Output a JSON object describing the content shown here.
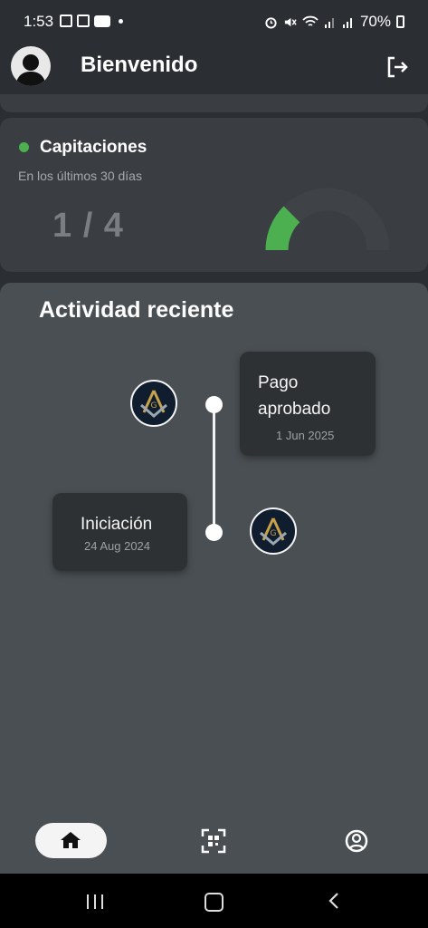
{
  "status_bar": {
    "time": "1:53",
    "battery": "70%"
  },
  "header": {
    "title": "Bienvenido"
  },
  "capitaciones": {
    "title": "Capitaciones",
    "subtitle": "En los últimos 30 días",
    "value": "1 / 4",
    "progress_fraction": 0.25,
    "colors": {
      "indicator": "#4cb050",
      "fill": "#4cb050",
      "track": "#3f4246"
    }
  },
  "activity": {
    "title": "Actividad reciente",
    "items": [
      {
        "label_line1": "Pago",
        "label_line2": "aprobado",
        "date": "1 Jun 2025"
      },
      {
        "label": "Iniciación",
        "date": "24 Aug 2024"
      }
    ]
  },
  "bottom_nav": {
    "items": [
      "home-icon",
      "qr-code-icon",
      "profile-icon"
    ],
    "active": "home"
  }
}
